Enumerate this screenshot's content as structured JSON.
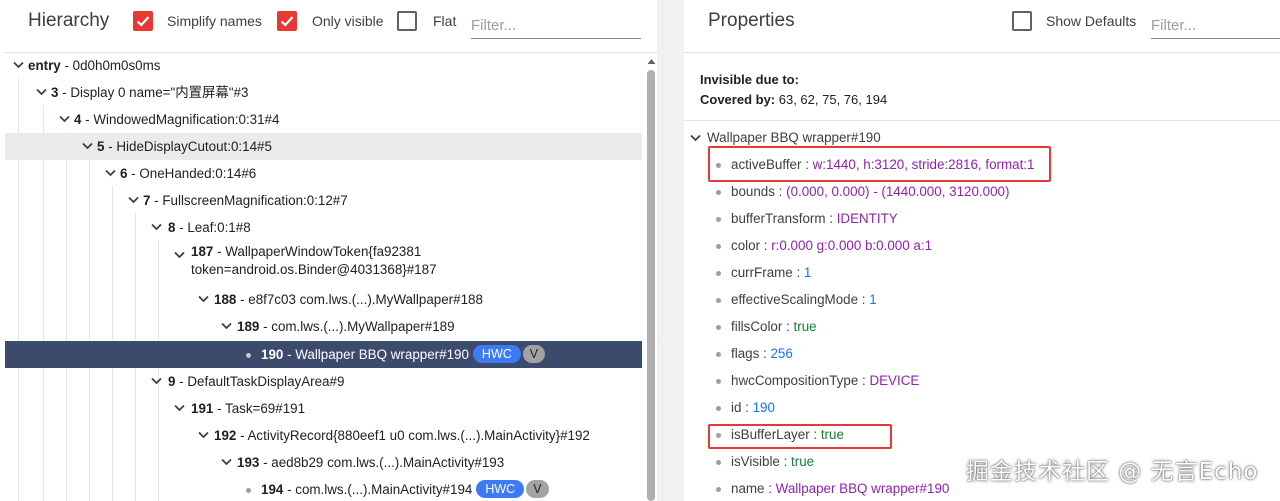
{
  "hierarchy": {
    "title": "Hierarchy",
    "simplify_label": "Simplify names",
    "only_visible_label": "Only visible",
    "flat_label": "Flat",
    "filter_placeholder": "Filter...",
    "nodes": [
      {
        "id": "entry",
        "name": " - 0d0h0m0s0ms"
      },
      {
        "id": "3",
        "name": " - Display 0 name=\"内置屏幕\"#3"
      },
      {
        "id": "4",
        "name": " - WindowedMagnification:0:31#4"
      },
      {
        "id": "5",
        "name": " - HideDisplayCutout:0:14#5"
      },
      {
        "id": "6",
        "name": " - OneHanded:0:14#6"
      },
      {
        "id": "7",
        "name": " - FullscreenMagnification:0:12#7"
      },
      {
        "id": "8",
        "name": " - Leaf:0:1#8"
      },
      {
        "id": "187",
        "name": " - WallpaperWindowToken{fa92381",
        "name2": "token=android.os.Binder@4031368}#187"
      },
      {
        "id": "188",
        "name": " - e8f7c03 com.lws.(...).MyWallpaper#188"
      },
      {
        "id": "189",
        "name": " - com.lws.(...).MyWallpaper#189"
      },
      {
        "id": "190",
        "name": " - Wallpaper BBQ wrapper#190",
        "chip1": "HWC",
        "chip2": "V"
      },
      {
        "id": "9",
        "name": " - DefaultTaskDisplayArea#9"
      },
      {
        "id": "191",
        "name": " - Task=69#191"
      },
      {
        "id": "192",
        "name": " - ActivityRecord{880eef1 u0 com.lws.(...).MainActivity}#192"
      },
      {
        "id": "193",
        "name": " - aed8b29 com.lws.(...).MainActivity#193"
      },
      {
        "id": "194",
        "name": " - com.lws.(...).MainActivity#194",
        "chip1": "HWC",
        "chip2": "V"
      }
    ]
  },
  "properties": {
    "title": "Properties",
    "show_defaults_label": "Show Defaults",
    "filter_placeholder": "Filter...",
    "invisible_heading": "Invisible due to:",
    "covered_by_label": "Covered by:",
    "covered_by_value": " 63, 62, 75, 76, 194",
    "node_title": "Wallpaper BBQ wrapper#190",
    "props": [
      {
        "key": "activeBuffer",
        "sep": " : ",
        "value": "w:1440, h:3120, stride:2816, format:1",
        "color": "purple"
      },
      {
        "key": "bounds",
        "sep": " : ",
        "value": "(0.000, 0.000) - (1440.000, 3120.000)",
        "color": "purple"
      },
      {
        "key": "bufferTransform",
        "sep": " : ",
        "value": "IDENTITY",
        "color": "purple"
      },
      {
        "key": "color",
        "sep": " : ",
        "value": "r:0.000 g:0.000 b:0.000 a:1",
        "color": "purple"
      },
      {
        "key": "currFrame",
        "sep": " : ",
        "value": "1",
        "color": "blue"
      },
      {
        "key": "effectiveScalingMode",
        "sep": " : ",
        "value": "1",
        "color": "blue"
      },
      {
        "key": "fillsColor",
        "sep": " : ",
        "value": "true",
        "color": "green"
      },
      {
        "key": "flags",
        "sep": " : ",
        "value": "256",
        "color": "blue"
      },
      {
        "key": "hwcCompositionType",
        "sep": " : ",
        "value": "DEVICE",
        "color": "purple"
      },
      {
        "key": "id",
        "sep": " : ",
        "value": "190",
        "color": "blue"
      },
      {
        "key": "isBufferLayer",
        "sep": " : ",
        "value": "true",
        "color": "green"
      },
      {
        "key": "isVisible",
        "sep": " : ",
        "value": "true",
        "color": "green"
      },
      {
        "key": "name",
        "sep": " : ",
        "value": "Wallpaper BBQ wrapper#190",
        "color": "purple"
      }
    ]
  },
  "watermark": "掘金技术社区 @ 无言Echo",
  "colors": {
    "accent": "#e53935",
    "selection": "#3c4b6b",
    "chip_hwc": "#3d7bf5",
    "chip_v": "#a3a3a3",
    "value_purple": "#8e24aa",
    "value_blue": "#1a73e8",
    "value_green": "#188038"
  }
}
